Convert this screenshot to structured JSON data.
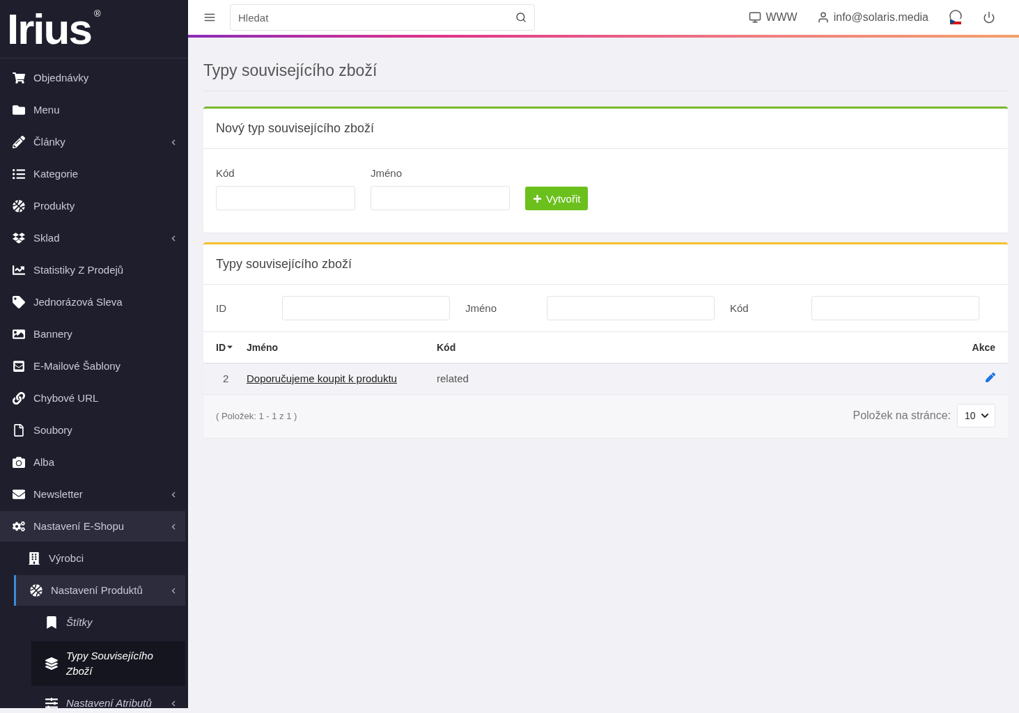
{
  "logo": {
    "text": "Irius",
    "mark": "®"
  },
  "topbar": {
    "search": {
      "placeholder": "Hledat"
    },
    "links": [
      {
        "kind": "www",
        "label": "WWW"
      },
      {
        "kind": "user",
        "label": "info@solaris.media"
      },
      {
        "kind": "flag"
      },
      {
        "kind": "power"
      }
    ]
  },
  "sidebar": {
    "items": [
      {
        "label": "Objednávky",
        "submenu": false
      },
      {
        "label": "Menu",
        "submenu": false
      },
      {
        "label": "Články",
        "submenu": true
      },
      {
        "label": "Kategorie",
        "submenu": false
      },
      {
        "label": "Produkty",
        "submenu": false
      },
      {
        "label": "Sklad",
        "submenu": true
      },
      {
        "label": "Statistiky Z Prodejů",
        "submenu": false
      },
      {
        "label": "Jednorázová Sleva",
        "submenu": false
      },
      {
        "label": "Bannery",
        "submenu": false
      },
      {
        "label": "E-Mailové Šablony",
        "submenu": false
      },
      {
        "label": "Chybové URL",
        "submenu": false
      },
      {
        "label": "Soubory",
        "submenu": false
      },
      {
        "label": "Alba",
        "submenu": false
      },
      {
        "label": "Newsletter",
        "submenu": true
      },
      {
        "label": "Nastavení E-Shopu",
        "submenu": true,
        "expanded": true,
        "children": [
          {
            "label": "Výrobci",
            "submenu": false
          },
          {
            "label": "Nastavení Produktů",
            "submenu": true,
            "expanded": true,
            "children": [
              {
                "label": "Štítky",
                "submenu": false,
                "selected": false
              },
              {
                "label": "Typy Souvisejícího Zboží",
                "submenu": false,
                "selected": true
              },
              {
                "label": "Nastavení Atributů",
                "submenu": true,
                "selected": false
              }
            ]
          }
        ]
      }
    ]
  },
  "page": {
    "title": "Typy souvisejícího zboží"
  },
  "create_card": {
    "title": "Nový typ souvisejícího zboží",
    "fields": [
      {
        "label": "Kód"
      },
      {
        "label": "Jméno"
      }
    ],
    "button": "Vytvořit"
  },
  "list_card": {
    "title": "Typy souvisejícího zboží",
    "filters": [
      {
        "label": "ID"
      },
      {
        "label": "Jméno"
      },
      {
        "label": "Kód"
      }
    ],
    "table": {
      "columns": [
        {
          "label": "ID",
          "sorted": true
        },
        {
          "label": "Jméno",
          "sorted": false
        },
        {
          "label": "Kód",
          "sorted": false
        },
        {
          "label": "Akce",
          "sorted": false
        }
      ],
      "rows": [
        {
          "id": "2",
          "name": "Doporučujeme koupit k produktu",
          "code": "related"
        }
      ]
    },
    "summary": "( Položek: 1 - 1 z 1 )",
    "per_page_label": "Položek na stránce:",
    "per_page": "10"
  }
}
